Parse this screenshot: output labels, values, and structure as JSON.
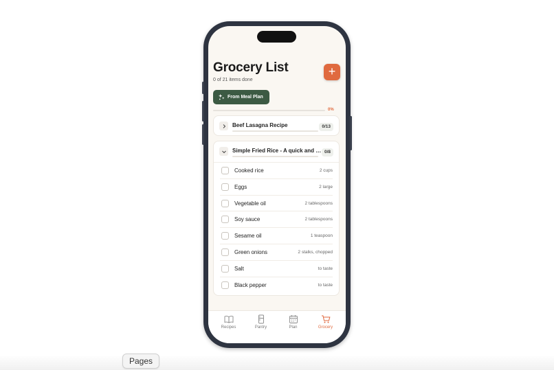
{
  "header": {
    "title": "Grocery List",
    "subtitle": "0 of 21 items done",
    "add_label": "+",
    "meal_plan_label": "From Meal Plan"
  },
  "progress": {
    "label": "0%",
    "fraction": 0
  },
  "recipes": [
    {
      "name": "Beef Lasagna Recipe",
      "count": "0/13",
      "expanded": false,
      "items": []
    },
    {
      "name": "Simple Fried Rice - A quick and easy side dish",
      "count": "0/8",
      "expanded": true,
      "items": [
        {
          "name": "Cooked rice",
          "qty": "2 cups"
        },
        {
          "name": "Eggs",
          "qty": "2 large"
        },
        {
          "name": "Vegetable oil",
          "qty": "2 tablespoons"
        },
        {
          "name": "Soy sauce",
          "qty": "2 tablespoons"
        },
        {
          "name": "Sesame oil",
          "qty": "1 teaspoon"
        },
        {
          "name": "Green onions",
          "qty": "2 stalks, chopped"
        },
        {
          "name": "Salt",
          "qty": "to taste"
        },
        {
          "name": "Black pepper",
          "qty": "to taste"
        }
      ]
    }
  ],
  "tabs": [
    {
      "label": "Recipes",
      "icon": "book-icon",
      "active": false
    },
    {
      "label": "Pantry",
      "icon": "fridge-icon",
      "active": false
    },
    {
      "label": "Plan",
      "icon": "calendar-icon",
      "active": false
    },
    {
      "label": "Grocery",
      "icon": "cart-icon",
      "active": true
    }
  ],
  "pages_button": "Pages",
  "colors": {
    "accent": "#e06a3f",
    "green": "#3c5a43",
    "background": "#faf7f2"
  }
}
